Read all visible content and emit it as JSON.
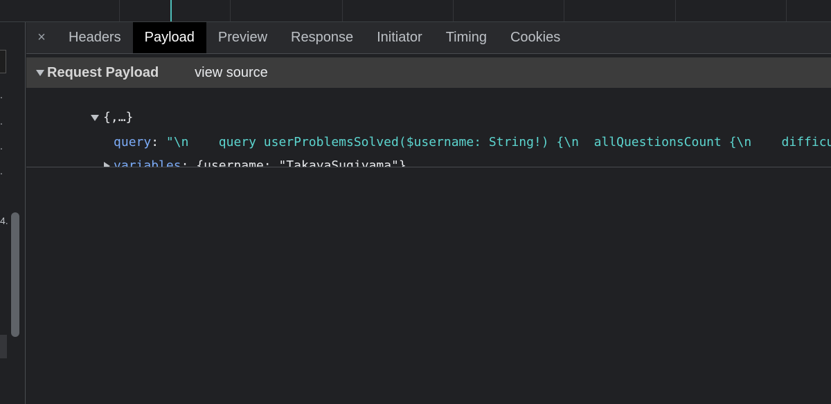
{
  "tabs": [
    {
      "label": "Headers",
      "active": false
    },
    {
      "label": "Payload",
      "active": true
    },
    {
      "label": "Preview",
      "active": false
    },
    {
      "label": "Response",
      "active": false
    },
    {
      "label": "Initiator",
      "active": false
    },
    {
      "label": "Timing",
      "active": false
    },
    {
      "label": "Cookies",
      "active": false
    }
  ],
  "close_glyph": "×",
  "section": {
    "title": "Request Payload",
    "view_source": "view source"
  },
  "tree": {
    "root_summary": "{,…}",
    "query": {
      "key": "query",
      "separator": ": ",
      "value": "\"\\n    query userProblemsSolved($username: String!) {\\n  allQuestionsCount {\\n    difficulty"
    },
    "variables": {
      "key": "variables",
      "separator": ": ",
      "value": "{username: \"TakayaSugiyama\"}"
    }
  },
  "colors": {
    "accent_marker": "#4fbfbb",
    "key": "#7cacf8",
    "string": "#5cd5cf",
    "active_tab_bg": "#000000"
  }
}
